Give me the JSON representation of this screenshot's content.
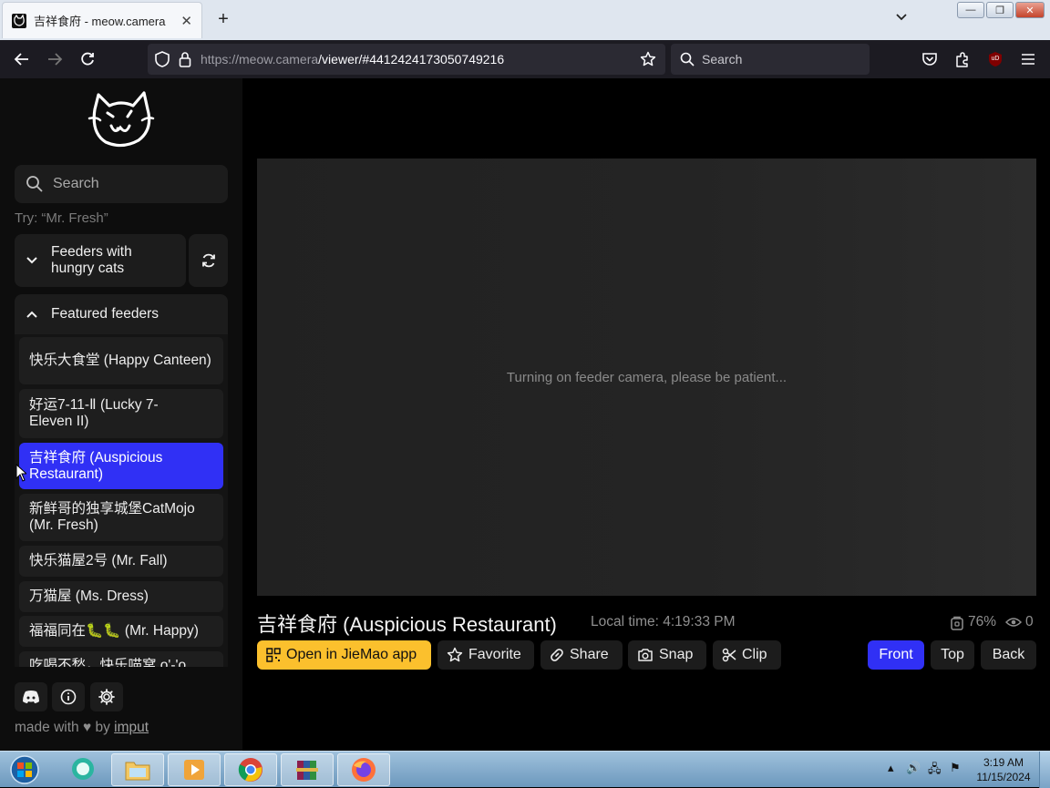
{
  "browser": {
    "tab_title": "吉祥食府 - meow.camera",
    "tab_close": "✕",
    "new_tab": "+",
    "url_domain": "https://meow.camera",
    "url_path": "/viewer/#4412424173050749216",
    "search_placeholder": "Search",
    "extension_badge": "uD"
  },
  "sidebar": {
    "search_placeholder": "Search",
    "hint": "Try: “Mr. Fresh”",
    "group_hungry": "Feeders with hungry cats",
    "group_featured": "Featured feeders",
    "items": [
      {
        "label": "快乐大食堂 (Happy Canteen)"
      },
      {
        "label": "好运7-11-Ⅱ (Lucky 7-Eleven II)"
      },
      {
        "label": "吉祥食府 (Auspicious Restaurant)",
        "selected": true
      },
      {
        "label": "新鲜哥的独享城堡CatMojo (Mr. Fresh)"
      },
      {
        "label": "快乐猫屋2号 (Mr. Fall)"
      },
      {
        "label": "万猫屋 (Ms. Dress)"
      },
      {
        "label": "福福同在🐛🐛 (Mr. Happy)"
      },
      {
        "label": "吃喝不愁，快乐喵窝 o'-'o"
      }
    ],
    "made_with": "made with",
    "by": "by",
    "author": "imput"
  },
  "viewer": {
    "loading_message": "Turning on feeder camera, please be patient...",
    "title": "吉祥食府 (Auspicious Restaurant)",
    "local_time": "Local time: 4:19:33 PM",
    "food_level": "76%",
    "viewers": "0",
    "buttons": {
      "open_app": "Open in JieMao app",
      "favorite": "Favorite",
      "share": "Share",
      "snap": "Snap",
      "clip": "Clip"
    },
    "camera_views": [
      "Front",
      "Top",
      "Back"
    ],
    "active_view": "Front"
  },
  "taskbar": {
    "time": "3:19 AM",
    "date": "11/15/2024"
  },
  "colors": {
    "accent": "#3030f5",
    "app_button": "#fbc02d"
  }
}
